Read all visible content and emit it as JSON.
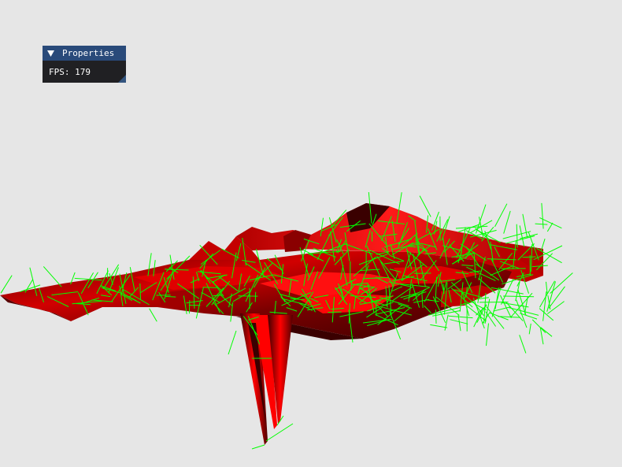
{
  "window": {
    "title": "Properties",
    "collapse_icon": "triangle-down-icon",
    "fps_label": "FPS:",
    "fps_value": "179"
  },
  "colors": {
    "background": "#e6e6e6",
    "title_bar": "#294a7a",
    "window_bg": "#0f0f12",
    "surface_bright": "#ff0000",
    "surface_dark": "#3a0000",
    "normals": "#00ff00"
  }
}
